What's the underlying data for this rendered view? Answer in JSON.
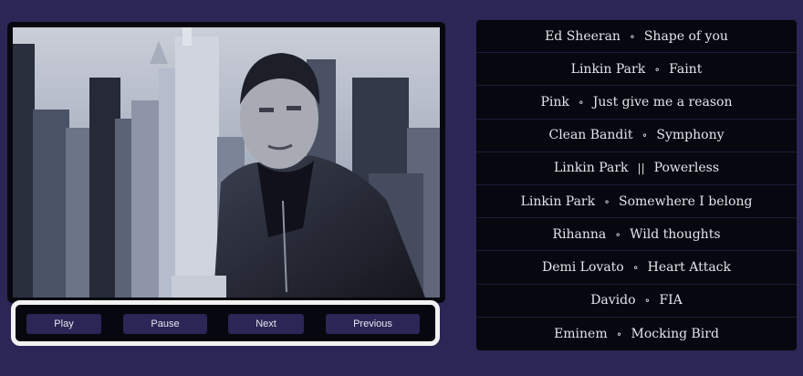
{
  "controls": {
    "play_label": "Play",
    "pause_label": "Pause",
    "next_label": "Next",
    "previous_label": "Previous"
  },
  "playlist": [
    {
      "artist": "Ed Sheeran",
      "sep": "∘",
      "title": "Shape of you"
    },
    {
      "artist": "Linkin Park",
      "sep": "∘",
      "title": "Faint"
    },
    {
      "artist": "Pink",
      "sep": "∘",
      "title": "Just give me a reason"
    },
    {
      "artist": "Clean Bandit",
      "sep": "∘",
      "title": "Symphony"
    },
    {
      "artist": "Linkin Park",
      "sep": "||",
      "title": "Powerless"
    },
    {
      "artist": "Linkin Park",
      "sep": "∘",
      "title": "Somewhere I belong"
    },
    {
      "artist": "Rihanna",
      "sep": "∘",
      "title": "Wild thoughts"
    },
    {
      "artist": "Demi Lovato",
      "sep": "∘",
      "title": "Heart Attack"
    },
    {
      "artist": "Davido",
      "sep": "∘",
      "title": "FIA"
    },
    {
      "artist": "Eminem",
      "sep": "∘",
      "title": "Mocking Bird"
    }
  ],
  "colors": {
    "page_bg": "#2b2655",
    "panel_bg": "#07070f",
    "button_bg": "#2b2655",
    "text": "#e4e4ee"
  }
}
